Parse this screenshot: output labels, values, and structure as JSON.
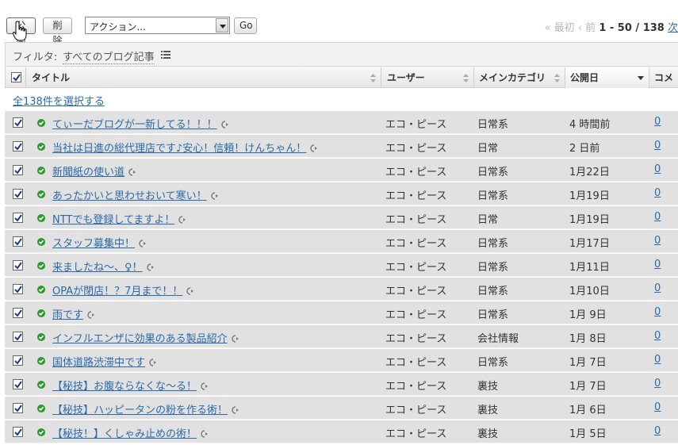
{
  "toolbar": {
    "publish_label": "公開",
    "delete_label": "削除",
    "action_select_value": "アクション...",
    "go_label": "Go"
  },
  "pager": {
    "first_label": "« 最初",
    "prev_label": "‹ 前",
    "range": "1 - 50 / 138",
    "next_label": "次"
  },
  "filter": {
    "label": "フィルタ:",
    "value": "すべてのブログ記事"
  },
  "columns": {
    "title": "タイトル",
    "user": "ユーザー",
    "category": "メインカテゴリ",
    "date": "公開日",
    "comments": "コメン"
  },
  "select_all_label": "全138件を選択する",
  "colors": {
    "link": "#2b6aa8",
    "row_bg": "#e1e1e1",
    "status_green": "#2a9a2a"
  },
  "icons": {
    "status": "published-check-icon",
    "preview": "preview-link-icon",
    "filter_menu": "list-menu-icon"
  },
  "rows": [
    {
      "title": "てぃーだブログが一新してる！！！",
      "user": "エコ・ピース",
      "category": "日常系",
      "date": "4 時間前",
      "comments": "0"
    },
    {
      "title": "当社は日進の総代理店です♪安心！信頼！けんちゃん！",
      "user": "エコ・ピース",
      "category": "日常",
      "date": "2 日前",
      "comments": "0"
    },
    {
      "title": "新聞紙の使い道",
      "user": "エコ・ピース",
      "category": "日常系",
      "date": "1月22日",
      "comments": "0"
    },
    {
      "title": "あったかいと思わせおいて寒い！",
      "user": "エコ・ピース",
      "category": "日常系",
      "date": "1月19日",
      "comments": "0"
    },
    {
      "title": "NTTでも登録してますよ！",
      "user": "エコ・ピース",
      "category": "日常",
      "date": "1月19日",
      "comments": "0"
    },
    {
      "title": "スタッフ募集中！",
      "user": "エコ・ピース",
      "category": "日常系",
      "date": "1月17日",
      "comments": "0"
    },
    {
      "title": "来ましたね〜、♀！",
      "user": "エコ・ピース",
      "category": "日常系",
      "date": "1月11日",
      "comments": "0"
    },
    {
      "title": "OPAが閉店！？7月まで！！",
      "user": "エコ・ピース",
      "category": "日常系",
      "date": "1月10日",
      "comments": "0"
    },
    {
      "title": "雨です",
      "user": "エコ・ピース",
      "category": "日常系",
      "date": "1月 9日",
      "comments": "0"
    },
    {
      "title": "インフルエンザに効果のある製品紹介",
      "user": "エコ・ピース",
      "category": "会社情報",
      "date": "1月 8日",
      "comments": "0"
    },
    {
      "title": "国体道路渋滞中です",
      "user": "エコ・ピース",
      "category": "日常系",
      "date": "1月 7日",
      "comments": "0"
    },
    {
      "title": "【秘技】お腹ならなくな〜る！",
      "user": "エコ・ピース",
      "category": "裏技",
      "date": "1月 7日",
      "comments": "0"
    },
    {
      "title": "【秘技】ハッピータンの粉を作る術！",
      "user": "エコ・ピース",
      "category": "裏技",
      "date": "1月 6日",
      "comments": "0"
    },
    {
      "title": "【秘技！】くしゃみ止めの術！",
      "user": "エコ・ピース",
      "category": "裏技",
      "date": "1月 5日",
      "comments": "0"
    }
  ]
}
